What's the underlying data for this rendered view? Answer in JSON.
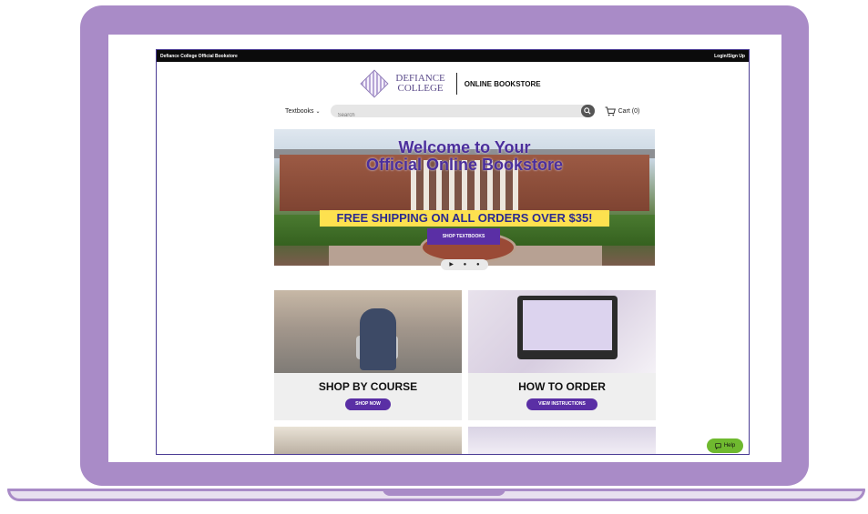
{
  "topbar": {
    "store_name": "Defiance College Official Bookstore",
    "login": "Login/Sign Up"
  },
  "header": {
    "logo_line1": "DEFIANCE",
    "logo_line2": "COLLEGE",
    "store_title": "ONLINE BOOKSTORE"
  },
  "nav": {
    "textbooks": "Textbooks",
    "search_placeholder": "Search",
    "cart": "Cart (0)"
  },
  "hero": {
    "title_line1": "Welcome to Your",
    "title_line2": "Official Online Bookstore",
    "banner": "FREE SHIPPING ON ALL ORDERS OVER $35!",
    "button": "SHOP TEXTBOOKS"
  },
  "cards": [
    {
      "title": "SHOP BY COURSE",
      "button": "SHOP NOW"
    },
    {
      "title": "HOW TO ORDER",
      "button": "VIEW INSTRUCTIONS"
    }
  ],
  "help": {
    "label": "Help"
  },
  "colors": {
    "frame": "#a98bc7",
    "accent_purple": "#5a2fa5",
    "banner_yellow": "#fde14f",
    "help_green": "#6fb92f"
  }
}
